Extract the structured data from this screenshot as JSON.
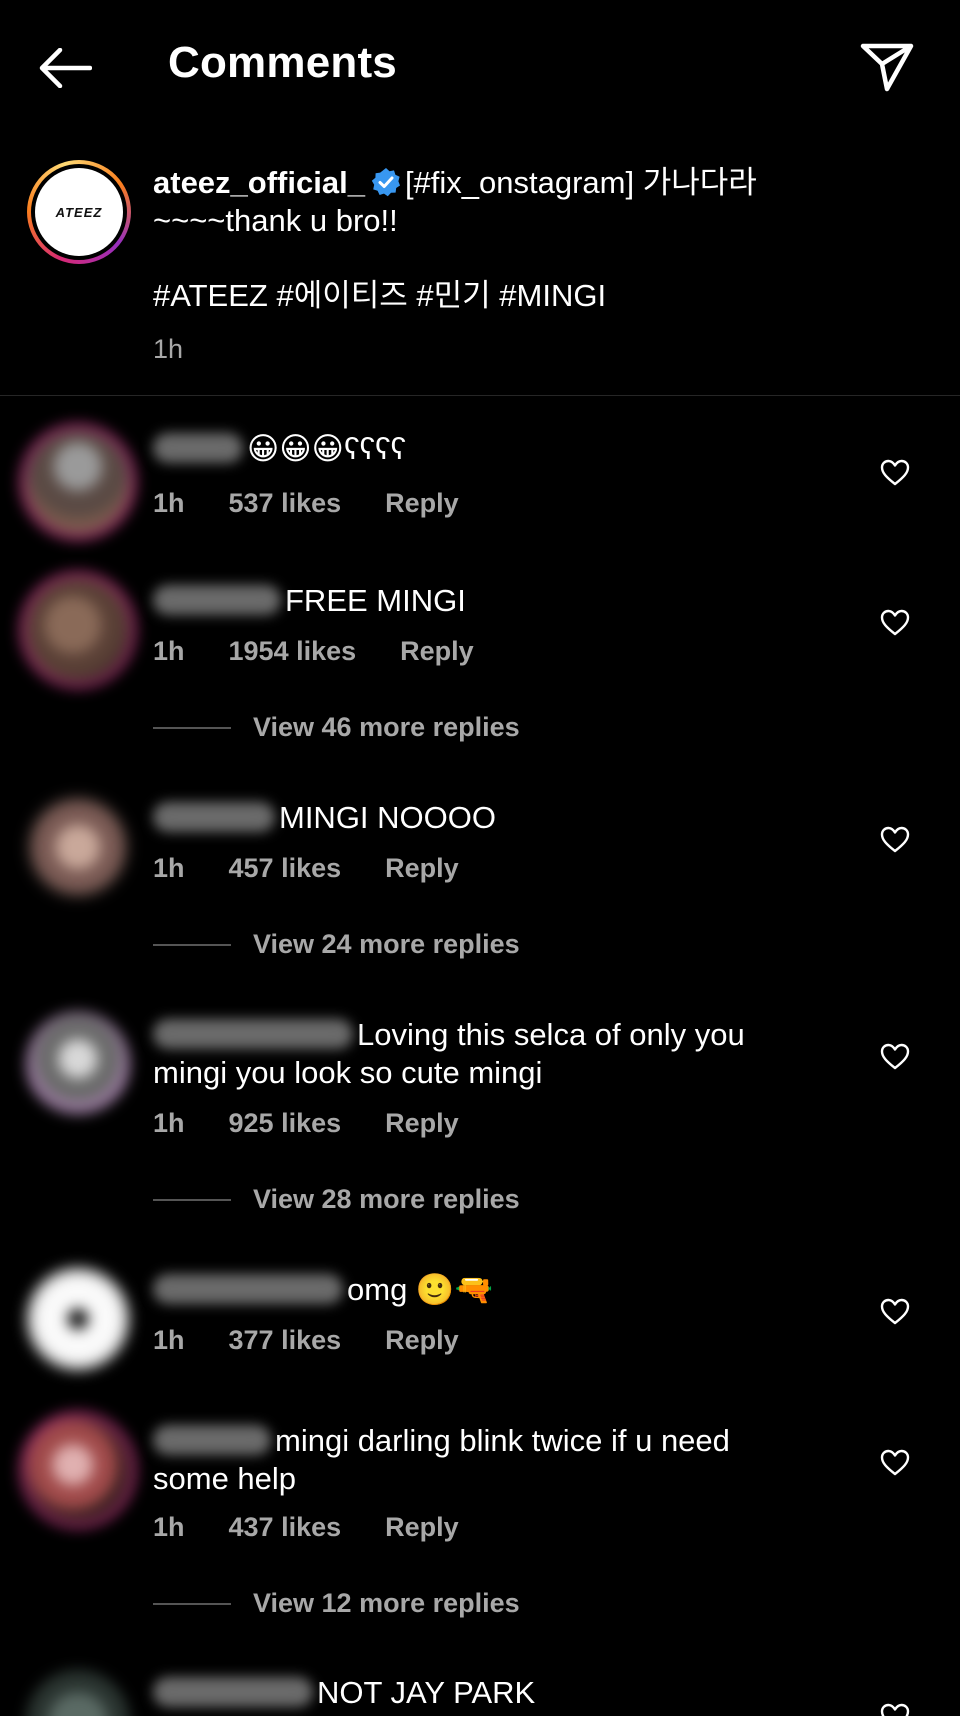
{
  "header": {
    "title": "Comments",
    "back_icon": "arrow-left-icon",
    "share_icon": "paper-plane-icon"
  },
  "caption": {
    "username": "ateez_official_",
    "text_line1": "[#fix_onstagram] 가나다라",
    "text_line2": "~~~~thank u bro!!",
    "tags": "#ATEEZ #에이티즈 #민기 #MINGI",
    "time": "1h",
    "logo_text": "ATEEZ",
    "verified_color": "#3897f0"
  },
  "comments": [
    {
      "text": "😀😀😀ʕʕʕʕ",
      "time": "1h",
      "likes": "537 likes",
      "reply": "Reply"
    },
    {
      "text": "FREE MINGI",
      "time": "1h",
      "likes": "1954 likes",
      "reply": "Reply",
      "view_replies": "View 46 more replies"
    },
    {
      "text": "MINGI NOOOO",
      "time": "1h",
      "likes": "457 likes",
      "reply": "Reply",
      "view_replies": "View 24 more replies"
    },
    {
      "text": "Loving this selca of only you",
      "text2": "mingi you look so cute mingi",
      "time": "1h",
      "likes": "925 likes",
      "reply": "Reply",
      "view_replies": "View 28 more replies"
    },
    {
      "text": "omg 🙂🔫",
      "time": "1h",
      "likes": "377 likes",
      "reply": "Reply"
    },
    {
      "text": "mingi darling blink twice if u need",
      "text2": "some help",
      "time": "1h",
      "likes": "437 likes",
      "reply": "Reply",
      "view_replies": "View 12 more replies"
    },
    {
      "text": "NOT JAY PARK"
    }
  ]
}
